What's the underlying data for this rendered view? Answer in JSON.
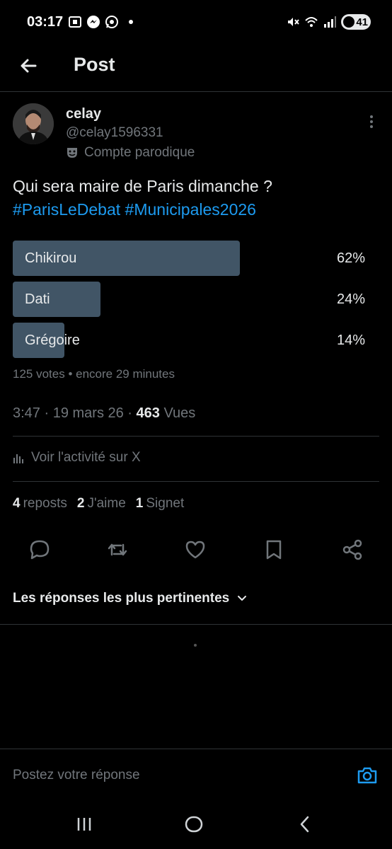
{
  "status_bar": {
    "time": "03:17",
    "battery": "41",
    "left_icons": [
      "screenshot-icon",
      "messenger-icon",
      "whatsapp-icon"
    ],
    "right_icons": [
      "mute-icon",
      "wifi-icon",
      "signal-icon"
    ]
  },
  "header": {
    "title": "Post"
  },
  "post": {
    "display_name": "celay",
    "handle": "@celay1596331",
    "badge": "Compte parodique",
    "text": "Qui sera maire de Paris dimanche ?",
    "hashtags": [
      "#ParisLeDebat",
      "#Municipales2026"
    ],
    "poll": {
      "options": [
        {
          "label": "Chikirou",
          "percent_text": "62%",
          "percent": 62
        },
        {
          "label": "Dati",
          "percent_text": "24%",
          "percent": 24
        },
        {
          "label": "Grégoire",
          "percent_text": "14%",
          "percent": 14
        }
      ],
      "meta": "125 votes • encore 29 minutes"
    },
    "time": "3:47 · 19 mars 26 · ",
    "views_count": "463",
    "views_label": " Vues",
    "activity_label": "Voir l'activité sur X",
    "stats": {
      "reposts_count": "4",
      "reposts_label": "reposts",
      "likes_count": "2",
      "likes_label": "J'aime",
      "bookmarks_count": "1",
      "bookmarks_label": "Signet"
    }
  },
  "replies": {
    "sort_label": "Les réponses les plus pertinentes"
  },
  "reply_box": {
    "placeholder": "Postez votre réponse"
  },
  "colors": {
    "accent": "#1d9bf0",
    "poll_bar": "#415566",
    "muted": "#71767b",
    "text": "#e7e9ea",
    "background": "#000000"
  }
}
